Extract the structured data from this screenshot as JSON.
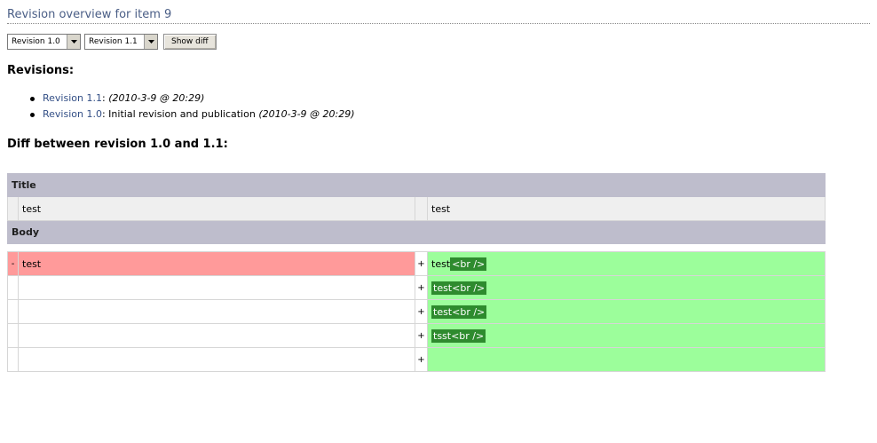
{
  "page": {
    "title": "Revision overview for item 9"
  },
  "controls": {
    "select_left": {
      "value": "Revision 1.0"
    },
    "select_right": {
      "value": "Revision 1.1"
    },
    "show_diff_label": "Show diff"
  },
  "revisions": {
    "heading": "Revisions:",
    "items": [
      {
        "link": "Revision 1.1",
        "sep": ":",
        "note": "",
        "date": "(2010-3-9 @ 20:29)"
      },
      {
        "link": "Revision 1.0",
        "sep": ":",
        "note": " Initial revision and publication ",
        "date": "(2010-3-9 @ 20:29)"
      }
    ]
  },
  "diff": {
    "heading": "Diff between revision 1.0 and 1.1:",
    "sections": {
      "title_label": "Title",
      "body_label": "Body"
    },
    "title_row": {
      "left": "test",
      "right": "test"
    },
    "body_rows": [
      {
        "left_mark": "-",
        "left": "test",
        "right_mark": "+",
        "right_plain": "test",
        "right_added": "<br />"
      },
      {
        "left_mark": "",
        "left": "",
        "right_mark": "+",
        "right_plain": "",
        "right_added": "test<br />"
      },
      {
        "left_mark": "",
        "left": "",
        "right_mark": "+",
        "right_plain": "",
        "right_added": "test<br />"
      },
      {
        "left_mark": "",
        "left": "",
        "right_mark": "+",
        "right_plain": "",
        "right_added": "tsst<br />"
      },
      {
        "left_mark": "",
        "left": "",
        "right_mark": "+",
        "right_plain": "",
        "right_added": ""
      }
    ]
  },
  "colors": {
    "link": "#334f86",
    "section_header": "#bebdcc",
    "deleted": "#ff9a9a",
    "inserted": "#9cfe9b",
    "inserted_highlight": "#2e8b2e"
  }
}
